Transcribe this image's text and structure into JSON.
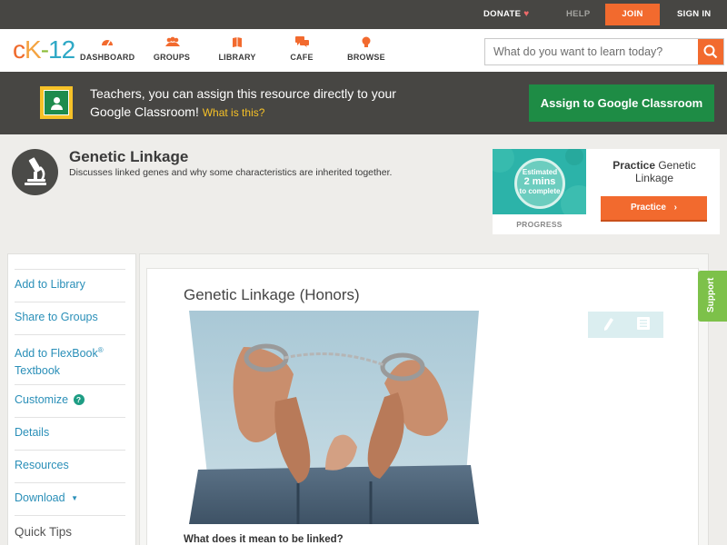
{
  "topbar": {
    "donate": "DONATE",
    "help": "HELP",
    "join": "JOIN",
    "signin": "SIGN IN"
  },
  "nav": {
    "logo": {
      "c": "c",
      "k": "K",
      "dash": "-",
      "n": "12"
    },
    "items": [
      {
        "label": "DASHBOARD",
        "icon": "dashboard-icon"
      },
      {
        "label": "GROUPS",
        "icon": "groups-icon"
      },
      {
        "label": "LIBRARY",
        "icon": "library-icon"
      },
      {
        "label": "CAFE",
        "icon": "cafe-icon"
      },
      {
        "label": "BROWSE",
        "icon": "browse-icon"
      }
    ],
    "search_placeholder": "What do you want to learn today?"
  },
  "banner": {
    "text": "Teachers, you can assign this resource directly to your Google Classroom!",
    "what_link": "What is this?",
    "assign_button": "Assign to Google Classroom"
  },
  "concept": {
    "title": "Genetic Linkage",
    "description": "Discusses linked genes and why some characteristics are inherited together."
  },
  "practice": {
    "estimate_top": "Estimated",
    "estimate_mins": "2 mins",
    "estimate_bottom": "to complete",
    "progress_label": "PROGRESS",
    "title_bold": "Practice",
    "title_rest": "Genetic Linkage",
    "button": "Practice"
  },
  "sidebar": {
    "add_library": "Add to Library",
    "share_groups": "Share to Groups",
    "add_flexbook_1": "Add to FlexBook",
    "add_flexbook_reg": "®",
    "add_flexbook_2": "Textbook",
    "customize": "Customize",
    "details": "Details",
    "resources": "Resources",
    "download": "Download",
    "quick_tips": "Quick Tips"
  },
  "article": {
    "title": "Genetic Linkage (Honors)",
    "subhead": "What does it mean to be linked?"
  },
  "support": "Support",
  "colors": {
    "accent": "#f26a2e",
    "assign_green": "#1e8c45",
    "link_blue": "#2a8fb8",
    "support_green": "#7dc14a"
  }
}
